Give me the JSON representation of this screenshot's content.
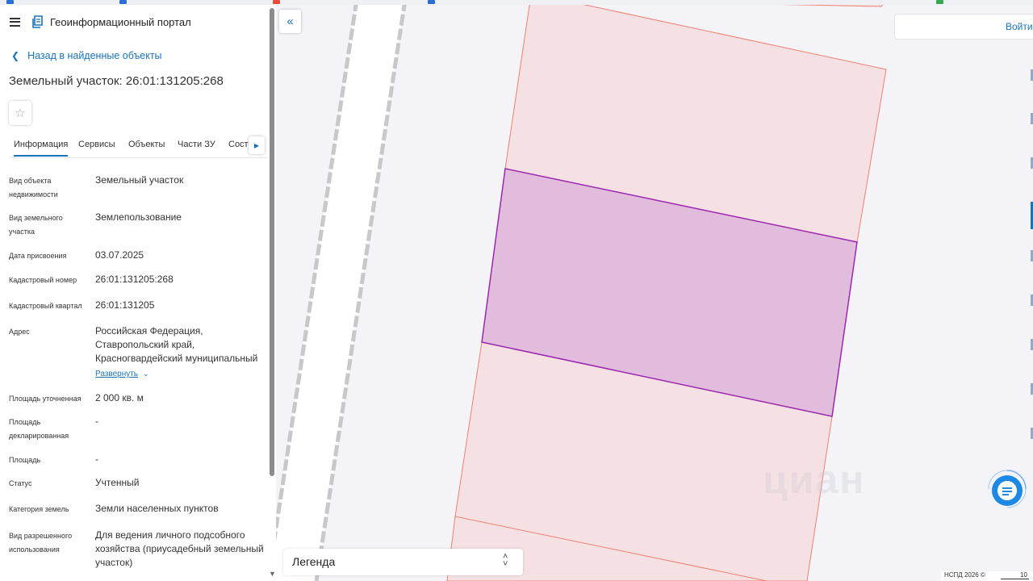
{
  "header": {
    "portal_title": "Геоинформационный портал"
  },
  "nav": {
    "back_label": "Назад в найденные объекты"
  },
  "object": {
    "title": "Земельный участок: 26:01:131205:268"
  },
  "tabs": [
    {
      "label": "Информация"
    },
    {
      "label": "Сервисы"
    },
    {
      "label": "Объекты"
    },
    {
      "label": "Части ЗУ"
    },
    {
      "label": "Соста"
    }
  ],
  "details": [
    {
      "label": "Вид объекта недвижимости",
      "value": "Земельный участок"
    },
    {
      "label": "Вид земельного участка",
      "value": "Землепользование"
    },
    {
      "label": "Дата присвоения",
      "value": "03.07.2025"
    },
    {
      "label": "Кадастровый номер",
      "value": "26:01:131205:268"
    },
    {
      "label": "Кадастровый квартал",
      "value": "26:01:131205"
    },
    {
      "label": "Адрес",
      "value": "Российская Федерация, Ставропольский край, Красногвардейский муниципальный"
    },
    {
      "label": "Площадь уточненная",
      "value": "2 000 кв. м"
    },
    {
      "label": "Площадь декларированная",
      "value": "-"
    },
    {
      "label": "Площадь",
      "value": "-"
    },
    {
      "label": "Статус",
      "value": "Учтенный"
    },
    {
      "label": "Категория земель",
      "value": "Земли населенных пунктов"
    },
    {
      "label": "Вид разрешенного использования",
      "value": "Для ведения личного подсобного хозяйства (приусадебный земельный участок)"
    }
  ],
  "address_expand_label": "Развернуть",
  "map": {
    "login_label": "Войти",
    "legend_label": "Легенда",
    "copyright": "НСПД 2026 ©",
    "scale_label": "10",
    "watermark": "циан"
  },
  "colors": {
    "accent": "#1a73b5",
    "selected_parcel_fill": "#e2bcdc",
    "selected_parcel_stroke": "#9c27b0",
    "parcel_fill": "#f5e1e4",
    "parcel_stroke": "#f08070"
  },
  "icons": {
    "menu": "hamburger-menu-icon",
    "back": "chevron-left-icon",
    "favorite": "star-outline-icon",
    "tab_scroll": "chevron-right-icon",
    "expand": "chevron-down-icon",
    "collapse_panel": "double-chevron-left-icon",
    "legend_toggle": "up-down-arrows-icon",
    "chat": "chat-icon"
  }
}
